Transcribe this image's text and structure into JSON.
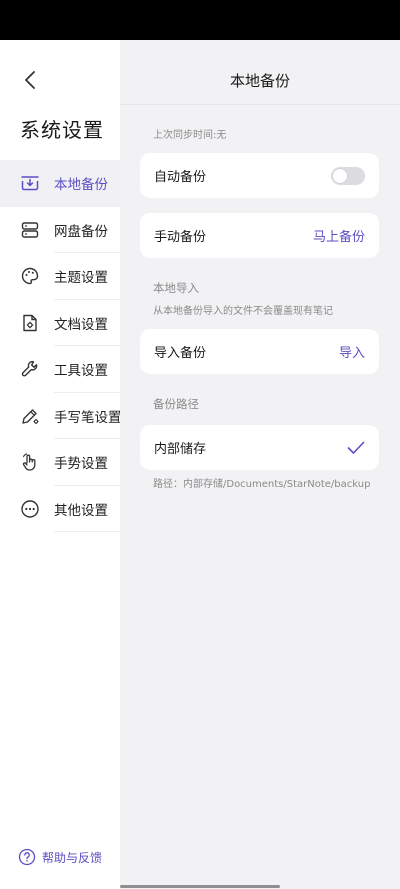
{
  "sidebar": {
    "title": "系统设置",
    "items": [
      {
        "label": "本地备份",
        "icon": "local-backup-icon",
        "active": true
      },
      {
        "label": "网盘备份",
        "icon": "cloud-drive-icon",
        "active": false
      },
      {
        "label": "主题设置",
        "icon": "palette-icon",
        "active": false
      },
      {
        "label": "文档设置",
        "icon": "document-settings-icon",
        "active": false
      },
      {
        "label": "工具设置",
        "icon": "wrench-icon",
        "active": false
      },
      {
        "label": "手写笔设置",
        "icon": "pen-settings-icon",
        "active": false
      },
      {
        "label": "手势设置",
        "icon": "gesture-hand-icon",
        "active": false
      },
      {
        "label": "其他设置",
        "icon": "more-dots-icon",
        "active": false
      }
    ],
    "help_label": "帮助与反馈"
  },
  "main": {
    "title": "本地备份",
    "last_sync": "上次同步时间:无",
    "auto_backup": {
      "label": "自动备份",
      "enabled": false
    },
    "manual_backup": {
      "label": "手动备份",
      "action": "马上备份"
    },
    "import_section": {
      "title": "本地导入",
      "hint": "从本地备份导入的文件不会覆盖现有笔记"
    },
    "import_backup": {
      "label": "导入备份",
      "action": "导入"
    },
    "path_section": {
      "title": "备份路径"
    },
    "internal_storage": {
      "label": "内部储存",
      "selected": true
    },
    "path_text": "路径：内部存储/Documents/StarNote/backup"
  },
  "colors": {
    "accent": "#5a4fc4",
    "panel_bg": "#f2f2f4",
    "status_bar": "#000000"
  }
}
